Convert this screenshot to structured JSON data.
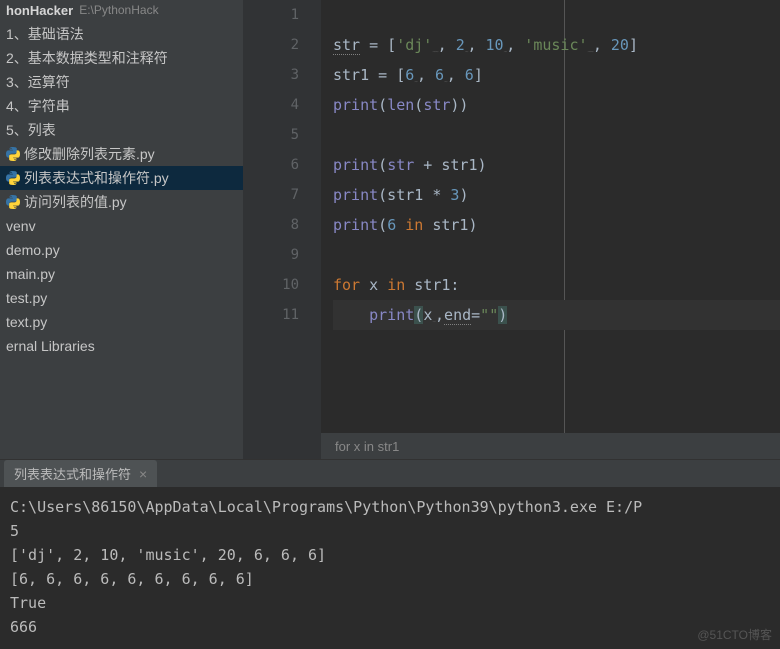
{
  "sidebar": {
    "project_name": "honHacker",
    "project_path": "E:\\PythonHack",
    "items": [
      {
        "label": "1、基础语法",
        "indent": 1,
        "icon": false
      },
      {
        "label": "2、基本数据类型和注释符",
        "indent": 1,
        "icon": false
      },
      {
        "label": "3、运算符",
        "indent": 1,
        "icon": false
      },
      {
        "label": "4、字符串",
        "indent": 1,
        "icon": false
      },
      {
        "label": "5、列表",
        "indent": 1,
        "icon": false
      },
      {
        "label": "修改删除列表元素.py",
        "indent": 2,
        "icon": true
      },
      {
        "label": "列表表达式和操作符.py",
        "indent": 2,
        "icon": true,
        "selected": true
      },
      {
        "label": "访问列表的值.py",
        "indent": 2,
        "icon": true
      },
      {
        "label": "venv",
        "indent": 1,
        "icon": false
      },
      {
        "label": "demo.py",
        "indent": 1,
        "icon": false
      },
      {
        "label": "main.py",
        "indent": 1,
        "icon": false
      },
      {
        "label": "test.py",
        "indent": 1,
        "icon": false
      },
      {
        "label": "text.py",
        "indent": 1,
        "icon": false
      },
      {
        "label": "ernal Libraries",
        "indent": 1,
        "icon": false
      }
    ]
  },
  "editor": {
    "line_numbers": [
      "1",
      "2",
      "3",
      "4",
      "5",
      "6",
      "7",
      "8",
      "9",
      "10",
      "11"
    ],
    "code_tokens": [
      [],
      [
        {
          "t": "str",
          "c": "underline-warn"
        },
        {
          "t": " = ["
        },
        {
          "t": "'dj'",
          "c": "str-lit"
        },
        {
          "t": "␣␣"
        },
        {
          "t": ", "
        },
        {
          "t": "2",
          "c": "num"
        },
        {
          "t": "␣"
        },
        {
          "t": ", "
        },
        {
          "t": "10",
          "c": "num"
        },
        {
          "t": "␣"
        },
        {
          "t": ", "
        },
        {
          "t": "'music'",
          "c": "str-lit"
        },
        {
          "t": "␣␣"
        },
        {
          "t": ", "
        },
        {
          "t": "20",
          "c": "num"
        },
        {
          "t": "]"
        }
      ],
      [
        {
          "t": "str1 = ["
        },
        {
          "t": "6",
          "c": "num"
        },
        {
          "t": "␣"
        },
        {
          "t": ", "
        },
        {
          "t": "6",
          "c": "num"
        },
        {
          "t": "␣"
        },
        {
          "t": ", "
        },
        {
          "t": "6",
          "c": "num"
        },
        {
          "t": "]"
        }
      ],
      [
        {
          "t": "print",
          "c": "builtin"
        },
        {
          "t": "("
        },
        {
          "t": "len",
          "c": "builtin"
        },
        {
          "t": "("
        },
        {
          "t": "str",
          "c": "builtin"
        },
        {
          "t": "))"
        }
      ],
      [],
      [
        {
          "t": "print",
          "c": "builtin"
        },
        {
          "t": "("
        },
        {
          "t": "str",
          "c": "builtin"
        },
        {
          "t": " + str1)"
        }
      ],
      [
        {
          "t": "print",
          "c": "builtin"
        },
        {
          "t": "(str1 * "
        },
        {
          "t": "3",
          "c": "num"
        },
        {
          "t": ")"
        }
      ],
      [
        {
          "t": "print",
          "c": "builtin"
        },
        {
          "t": "("
        },
        {
          "t": "6",
          "c": "num"
        },
        {
          "t": " "
        },
        {
          "t": "in",
          "c": "kw"
        },
        {
          "t": " str1)"
        }
      ],
      [],
      [
        {
          "t": "for ",
          "c": "kw"
        },
        {
          "t": "x "
        },
        {
          "t": "in ",
          "c": "kw"
        },
        {
          "t": "str1:"
        }
      ],
      [
        {
          "t": "    "
        },
        {
          "t": "print",
          "c": "builtin"
        },
        {
          "t": "(",
          "c": "highlight-paren"
        },
        {
          "t": "x"
        },
        {
          "t": "␣"
        },
        {
          "t": ","
        },
        {
          "t": "end",
          "c": "underline-warn"
        },
        {
          "t": "="
        },
        {
          "t": "\"\"",
          "c": "str-lit"
        },
        {
          "t": ")",
          "c": "highlight-paren"
        }
      ]
    ],
    "breadcrumb": "for x in str1"
  },
  "terminal": {
    "tab_title": "列表表达式和操作符",
    "lines": [
      "C:\\Users\\86150\\AppData\\Local\\Programs\\Python\\Python39\\python3.exe E:/P",
      "5",
      "['dj', 2, 10, 'music', 20, 6, 6, 6]",
      "[6, 6, 6, 6, 6, 6, 6, 6, 6]",
      "True",
      "666"
    ]
  },
  "watermark": "@51CTO博客"
}
